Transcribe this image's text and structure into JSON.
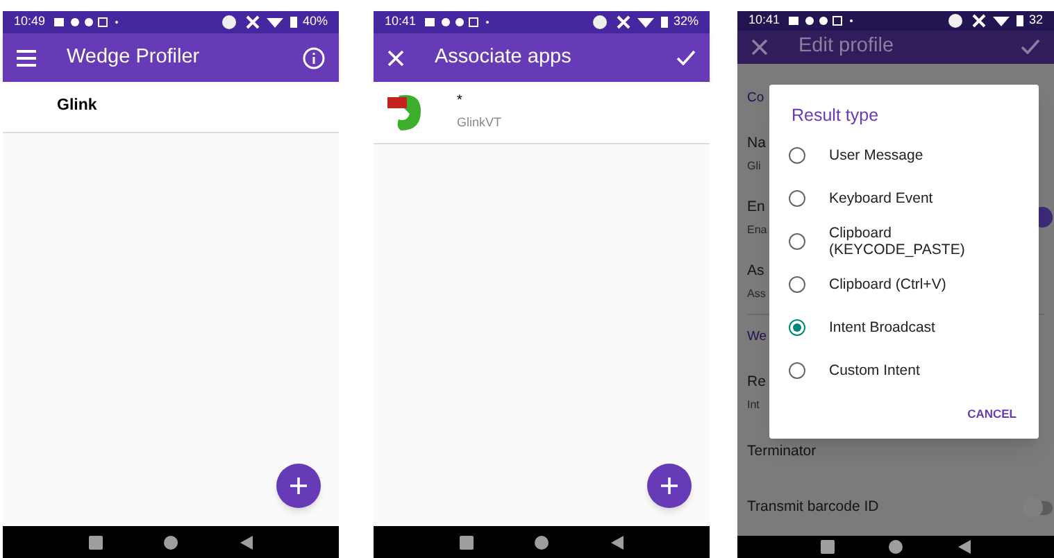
{
  "screens": [
    {
      "kind": "profiles",
      "status_bar": {
        "time": "10:49",
        "battery": "40%"
      },
      "toolbar": {
        "title": "Wedge Profiler"
      },
      "list": [
        {
          "title": "Glink"
        }
      ],
      "fab": true
    },
    {
      "kind": "associate",
      "status_bar": {
        "time": "10:41",
        "battery": "32%"
      },
      "toolbar": {
        "title": "Associate apps"
      },
      "list": [
        {
          "title": "*",
          "subtitle": "GlinkVT"
        }
      ],
      "fab": true
    },
    {
      "kind": "edit",
      "status_bar": {
        "time": "10:41",
        "battery": "32"
      },
      "toolbar": {
        "title": "Edit profile"
      },
      "settings": [
        {
          "kind": "header",
          "title": "Co"
        },
        {
          "kind": "item",
          "title": "Na",
          "subtitle": "Gli"
        },
        {
          "kind": "switch",
          "title": "En",
          "subtitle": "Ena",
          "on": true
        },
        {
          "kind": "item",
          "title": "As",
          "subtitle": "Ass"
        },
        {
          "kind": "header",
          "title": "We"
        },
        {
          "kind": "item",
          "title": "Re",
          "subtitle": "Int"
        },
        {
          "kind": "item",
          "title": "Terminator"
        },
        {
          "kind": "switch",
          "title": "Transmit barcode ID",
          "on": false
        }
      ],
      "dialog": {
        "title": "Result type",
        "options": [
          {
            "label": "User Message",
            "selected": false
          },
          {
            "label": "Keyboard Event",
            "selected": false
          },
          {
            "label": "Clipboard (KEYCODE_PASTE)",
            "selected": false
          },
          {
            "label": "Clipboard (Ctrl+V)",
            "selected": false
          },
          {
            "label": "Intent Broadcast",
            "selected": true
          },
          {
            "label": "Custom Intent",
            "selected": false
          }
        ],
        "button": "CANCEL"
      }
    }
  ]
}
